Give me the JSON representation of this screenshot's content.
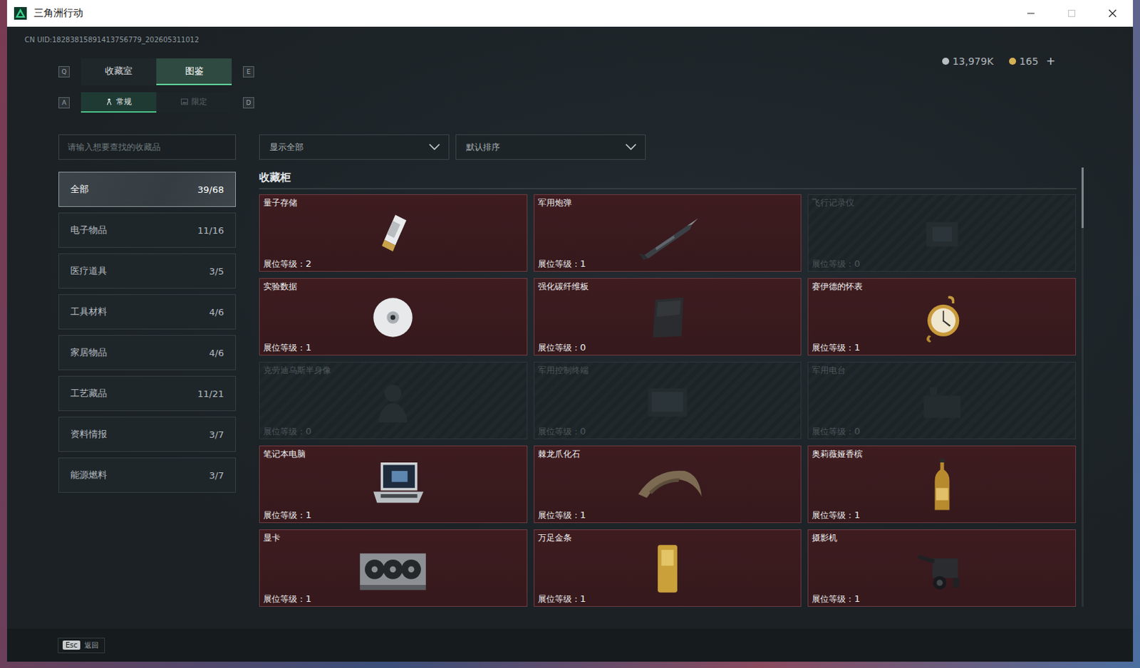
{
  "window": {
    "title": "三角洲行动",
    "controls": [
      {
        "kind": "minimize",
        "disabled": false
      },
      {
        "kind": "maximize",
        "disabled": true
      },
      {
        "kind": "close",
        "disabled": false
      }
    ]
  },
  "uid": "CN UID:18283815891413756779_202605311012",
  "currency": [
    {
      "value": "13,979K",
      "color": "#b9bec2",
      "add": ""
    },
    {
      "value": "165",
      "color": "#d6b055",
      "add": "+"
    }
  ],
  "main_tabs": {
    "prev_key": "Q",
    "next_key": "E",
    "items": [
      {
        "label": "收藏室",
        "selected": false
      },
      {
        "label": "图鉴",
        "selected": true
      }
    ]
  },
  "sub_tabs": {
    "prev_key": "A",
    "next_key": "D",
    "items": [
      {
        "label": "常规",
        "selected": true
      },
      {
        "label": "限定",
        "selected": false
      }
    ]
  },
  "search": {
    "placeholder": "请输入想要查找的收藏品"
  },
  "categories": [
    {
      "label": "全部",
      "count": "39/68",
      "selected": true
    },
    {
      "label": "电子物品",
      "count": "11/16",
      "selected": false
    },
    {
      "label": "医疗道具",
      "count": "3/5",
      "selected": false
    },
    {
      "label": "工具材料",
      "count": "4/6",
      "selected": false
    },
    {
      "label": "家居物品",
      "count": "4/6",
      "selected": false
    },
    {
      "label": "工艺藏品",
      "count": "11/21",
      "selected": false
    },
    {
      "label": "资料情报",
      "count": "3/7",
      "selected": false
    },
    {
      "label": "能源燃料",
      "count": "3/7",
      "selected": false
    }
  ],
  "filters": [
    {
      "value": "显示全部"
    },
    {
      "value": "默认排序"
    }
  ],
  "cabinet": {
    "title": "收藏柜",
    "level_label": "展位等级：",
    "items": [
      {
        "name": "量子存储",
        "level": "2",
        "unlocked": true
      },
      {
        "name": "军用炮弹",
        "level": "1",
        "unlocked": true
      },
      {
        "name": "飞行记录仪",
        "level": "0",
        "unlocked": false
      },
      {
        "name": "实验数据",
        "level": "1",
        "unlocked": true
      },
      {
        "name": "强化碳纤维板",
        "level": "0",
        "unlocked": true
      },
      {
        "name": "赛伊德的怀表",
        "level": "1",
        "unlocked": true
      },
      {
        "name": "克劳迪乌斯半身像",
        "level": "0",
        "unlocked": false
      },
      {
        "name": "军用控制终端",
        "level": "0",
        "unlocked": false
      },
      {
        "name": "军用电台",
        "level": "0",
        "unlocked": false
      },
      {
        "name": "笔记本电脑",
        "level": "1",
        "unlocked": true
      },
      {
        "name": "棘龙爪化石",
        "level": "1",
        "unlocked": true
      },
      {
        "name": "奥莉薇娅香槟",
        "level": "1",
        "unlocked": true
      },
      {
        "name": "显卡",
        "level": "1",
        "unlocked": true
      },
      {
        "name": "万足金条",
        "level": "1",
        "unlocked": true
      },
      {
        "name": "摄影机",
        "level": "1",
        "unlocked": true
      }
    ]
  },
  "footer": {
    "key": "Esc",
    "label": "返回"
  }
}
